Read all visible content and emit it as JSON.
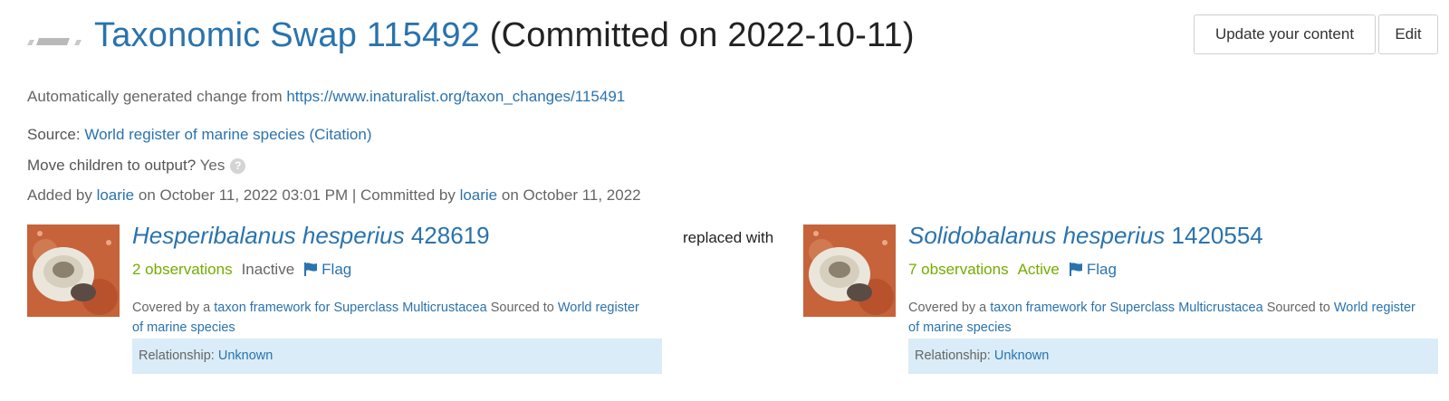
{
  "header": {
    "title_link": "Taxonomic Swap 115492",
    "title_rest": "(Committed on 2022-10-11)",
    "buttons": {
      "update": "Update your content",
      "edit": "Edit"
    }
  },
  "description": {
    "prefix": "Automatically generated change from ",
    "link": "https://www.inaturalist.org/taxon_changes/115491"
  },
  "source": {
    "label": "Source:",
    "name": "World register of marine species",
    "citation_open": " (",
    "citation": "Citation",
    "citation_close": ")"
  },
  "move_children": {
    "label": "Move children to output?",
    "value": " Yes",
    "help_icon": "question-circle-icon"
  },
  "added": {
    "prefix": "Added by ",
    "user1": "loarie",
    "mid": " on October 11, 2022 03:01 PM | Committed by ",
    "user2": "loarie",
    "suffix": " on October 11, 2022"
  },
  "replaced_with": "replaced with",
  "input_taxon": {
    "name": "Hesperibalanus hesperius",
    "id": " 428619",
    "observations": "2 observations",
    "status": "Inactive",
    "flag": "Flag",
    "covered_prefix": "Covered by a ",
    "framework": "taxon framework for Superclass Multicrustacea",
    "sourced_prefix": " Sourced to ",
    "sourced": "World register of marine species",
    "relationship_label": "Relationship: ",
    "relationship": "Unknown"
  },
  "output_taxon": {
    "name": "Solidobalanus hesperius",
    "id": " 1420554",
    "observations": "7 observations",
    "status": "Active",
    "flag": "Flag",
    "covered_prefix": "Covered by a ",
    "framework": "taxon framework for Superclass Multicrustacea",
    "sourced_prefix": " Sourced to ",
    "sourced": "World register of marine species",
    "relationship_label": "Relationship: ",
    "relationship": "Unknown"
  },
  "colors": {
    "link": "#2a73ad",
    "green": "#74ac00",
    "relationship_bg": "#d9ecf7"
  }
}
